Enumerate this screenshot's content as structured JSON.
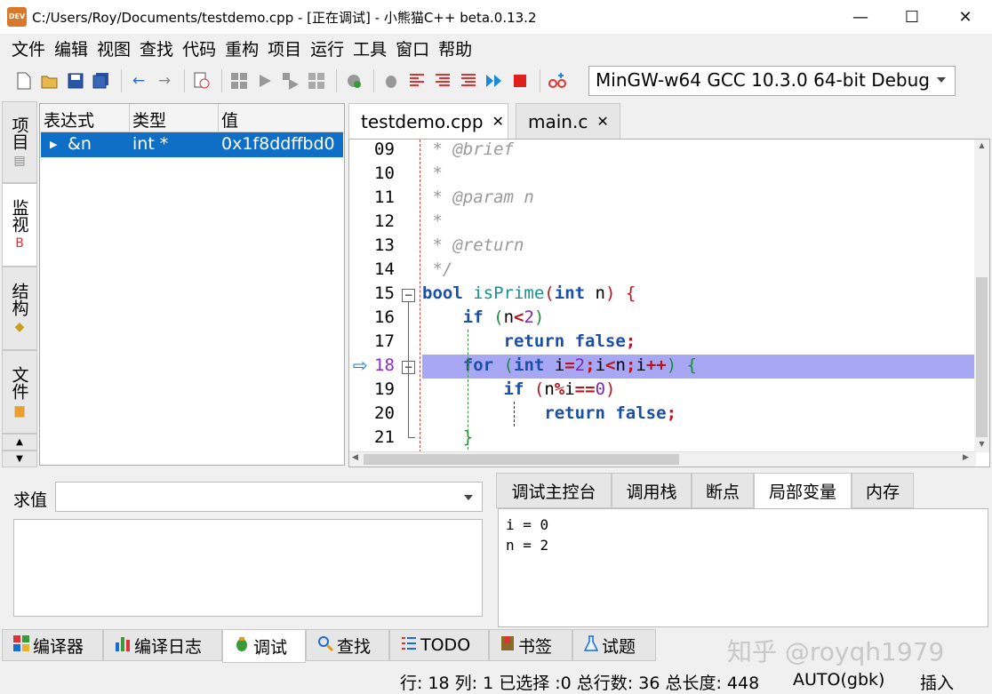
{
  "window": {
    "title": "C:/Users/Roy/Documents/testdemo.cpp - [正在调试] - 小熊猫C++ beta.0.13.2",
    "app_icon_text": "DEV",
    "minimize": "—",
    "maximize": "☐",
    "close": "✕"
  },
  "menu": [
    "文件",
    "编辑",
    "视图",
    "查找",
    "代码",
    "重构",
    "项目",
    "运行",
    "工具",
    "窗口",
    "帮助"
  ],
  "toolbar": {
    "compiler": "MinGW-w64 GCC 10.3.0 64-bit Debug"
  },
  "side_tabs": [
    {
      "label": "项目",
      "icon": "project-icon"
    },
    {
      "label": "监视",
      "icon": "watch-icon"
    },
    {
      "label": "结构",
      "icon": "structure-icon"
    },
    {
      "label": "文件",
      "icon": "folder-icon"
    }
  ],
  "watch": {
    "headers": [
      "表达式",
      "类型",
      "值"
    ],
    "rows": [
      {
        "expr": "&n",
        "type": "int *",
        "value": "0x1f8ddffbd0"
      }
    ]
  },
  "editor": {
    "tabs": [
      {
        "label": "testdemo.cpp",
        "close": "✕"
      },
      {
        "label": "main.c",
        "close": "✕"
      }
    ],
    "line_numbers": [
      "09",
      "10",
      "11",
      "12",
      "13",
      "14",
      "15",
      "16",
      "17",
      "18",
      "19",
      "20",
      "21"
    ],
    "current_line_marker": "⇨"
  },
  "eval": {
    "label": "求值",
    "value": ""
  },
  "debug_tabs": [
    "调试主控台",
    "调用栈",
    "断点",
    "局部变量",
    "内存"
  ],
  "locals": [
    "i = 0",
    "n = 2"
  ],
  "bottom_tabs": [
    {
      "label": "编译器",
      "icon": "compiler-icon"
    },
    {
      "label": "编译日志",
      "icon": "chart-icon"
    },
    {
      "label": "调试",
      "icon": "bug-icon"
    },
    {
      "label": "查找",
      "icon": "search-icon"
    },
    {
      "label": "TODO",
      "icon": "todo-icon"
    },
    {
      "label": "书签",
      "icon": "bookmark-icon"
    },
    {
      "label": "试题",
      "icon": "flask-icon"
    }
  ],
  "status": {
    "position": "行: 18 列: 1 已选择 :0 总行数: 36 总长度: 448",
    "encoding": "AUTO(gbk)",
    "mode": "插入"
  },
  "watermark": "知乎 @royqh1979"
}
